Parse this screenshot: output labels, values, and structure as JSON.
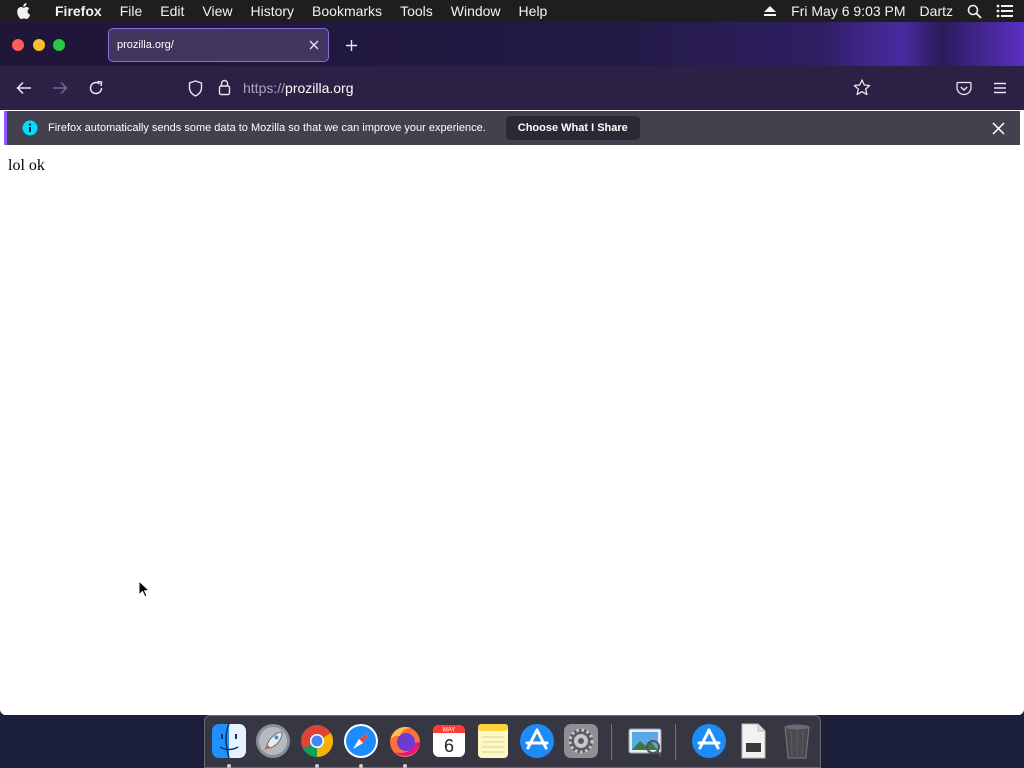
{
  "menubar": {
    "app_name": "Firefox",
    "items": [
      "File",
      "Edit",
      "View",
      "History",
      "Bookmarks",
      "Tools",
      "Window",
      "Help"
    ],
    "clock": "Fri May 6  9:03 PM",
    "user": "Dartz",
    "icons": [
      "apple-icon",
      "eject-icon",
      "spotlight-search-icon",
      "control-center-icon"
    ]
  },
  "browser": {
    "tab": {
      "title": "prozilla.org/"
    },
    "url": {
      "scheme": "https://",
      "host": "prozilla.org"
    },
    "notification": {
      "message": "Firefox automatically sends some data to Mozilla so that we can improve your experience.",
      "button": "Choose What I Share"
    },
    "page": {
      "text": "lol ok"
    }
  },
  "dock": {
    "apps": [
      "Finder",
      "Launchpad",
      "Google Chrome",
      "Safari",
      "Firefox",
      "Calendar",
      "Notes",
      "App Store",
      "System Preferences",
      "Preview",
      "Downloads",
      "Documents",
      "Trash"
    ],
    "calendar": {
      "month": "MAY",
      "day": "6"
    },
    "running": [
      "Finder",
      "Google Chrome",
      "Safari",
      "Firefox"
    ]
  },
  "colors": {
    "menubar_bg": "#1e1e1e",
    "tabstrip_bg": "#1f1638",
    "toolbar_bg": "#2b2145",
    "notification_bg": "#42414d",
    "accent": "#9059ff",
    "info_icon": "#00ddff"
  }
}
